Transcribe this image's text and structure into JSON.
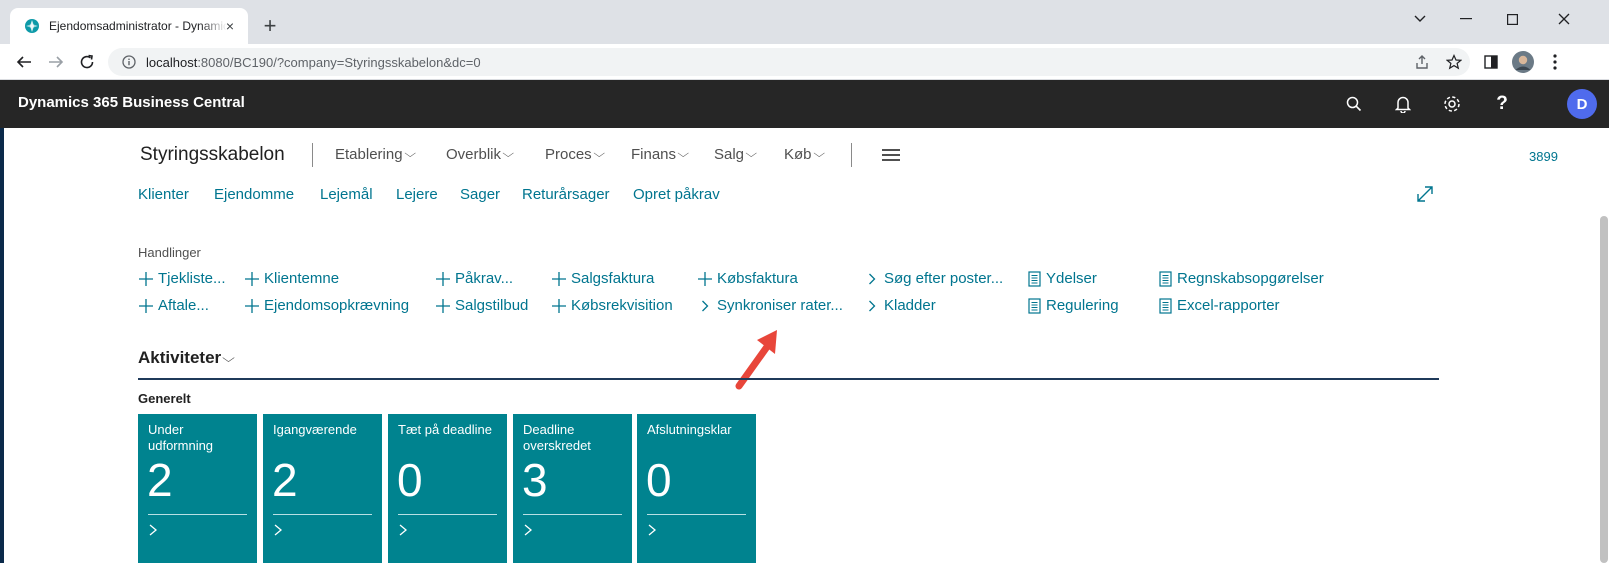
{
  "browser": {
    "tab_title": "Ejendomsadministrator - Dynamics 365 Business Central",
    "tab_close": "×",
    "new_tab": "+",
    "url_host": "localhost",
    "url_rest": ":8080/BC190/?company=Styringsskabelon&dc=0"
  },
  "bc": {
    "app_title": "Dynamics 365 Business Central",
    "avatar_initial": "D"
  },
  "rolecenter": {
    "company": "Styringsskabelon",
    "menus": [
      "Etablering",
      "Overblik",
      "Proces",
      "Finans",
      "Salg",
      "Køb"
    ],
    "count_link": "3899",
    "quicklinks": [
      "Klienter",
      "Ejendomme",
      "Lejemål",
      "Lejere",
      "Sager",
      "Returårsager",
      "Opret påkrav"
    ]
  },
  "actions": {
    "label": "Handlinger",
    "row1": [
      {
        "icon": "plus-icon",
        "label": "Tjekliste..."
      },
      {
        "icon": "plus-icon",
        "label": "Klientemne"
      },
      {
        "icon": "plus-icon",
        "label": "Påkrav..."
      },
      {
        "icon": "plus-icon",
        "label": "Salgsfaktura"
      },
      {
        "icon": "plus-icon",
        "label": "Købsfaktura"
      },
      {
        "icon": "chevron-right-icon",
        "label": "Søg efter poster..."
      },
      {
        "icon": "report-icon",
        "label": "Ydelser"
      },
      {
        "icon": "report-icon",
        "label": "Regnskabsopgørelser"
      }
    ],
    "row2": [
      {
        "icon": "plus-icon",
        "label": "Aftale..."
      },
      {
        "icon": "plus-icon",
        "label": "Ejendomsopkrævning"
      },
      {
        "icon": "plus-icon",
        "label": "Salgstilbud"
      },
      {
        "icon": "plus-icon",
        "label": "Købsrekvisition"
      },
      {
        "icon": "chevron-right-icon",
        "label": "Synkroniser rater..."
      },
      {
        "icon": "chevron-right-icon",
        "label": "Kladder"
      },
      {
        "icon": "report-icon",
        "label": "Regulering"
      },
      {
        "icon": "report-icon",
        "label": "Excel-rapporter"
      }
    ]
  },
  "activities": {
    "title": "Aktiviteter",
    "group": "Generelt",
    "tiles": [
      {
        "label": "Under udformning",
        "value": "2"
      },
      {
        "label": "Igangværende",
        "value": "2"
      },
      {
        "label": "Tæt på deadline",
        "value": "0"
      },
      {
        "label": "Deadline overskredet",
        "value": "3"
      },
      {
        "label": "Afslutningsklar",
        "value": "0"
      }
    ]
  },
  "colors": {
    "link": "#00758f",
    "tile": "#00838f",
    "header": "#262626",
    "annotation_arrow": "#e8463a"
  }
}
